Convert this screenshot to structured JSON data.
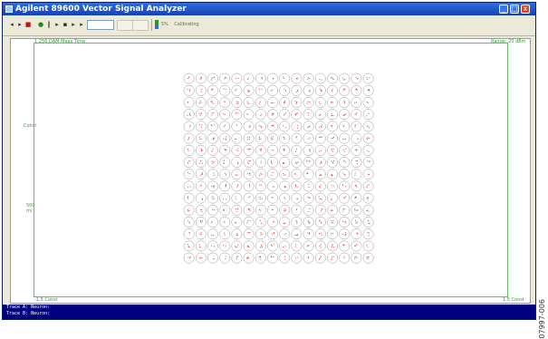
{
  "window": {
    "title": "Agilent 89600 Vector Signal Analyzer",
    "minimize_glyph": "_",
    "maximize_glyph": "□",
    "close_glyph": "x"
  },
  "toolbar": {
    "buttons": [
      {
        "name": "rewind-icon",
        "glyph": "◂"
      },
      {
        "name": "play-icon",
        "glyph": "▸"
      },
      {
        "name": "stop-icon",
        "glyph": "■"
      },
      {
        "name": "record-icon",
        "glyph": "●"
      },
      {
        "name": "pause-icon",
        "glyph": "‖"
      },
      {
        "name": "step-icon",
        "glyph": "▸"
      },
      {
        "name": "single-icon",
        "glyph": "▪"
      },
      {
        "name": "restart-icon",
        "glyph": "▸"
      },
      {
        "name": "next-icon",
        "glyph": "▸"
      }
    ],
    "input_value": "",
    "status_text": "5%    Calibrating"
  },
  "plot": {
    "top_left": "1 256 QAM Meas Time",
    "top_right": "Range: 20 dBm",
    "y_top": "Const",
    "y_mid": "500\nm/",
    "bottom_left": "-1.5 Const",
    "bottom_right": "1.5 Const",
    "grid_rows": 16,
    "grid_cols": 16,
    "circle_color": "#999999",
    "point_color": "#e0303a"
  },
  "status_bar": {
    "line1": "Trace A:  Neuron:",
    "line2": "Trace B:  Neuron:"
  },
  "figure_id": "07997-006"
}
